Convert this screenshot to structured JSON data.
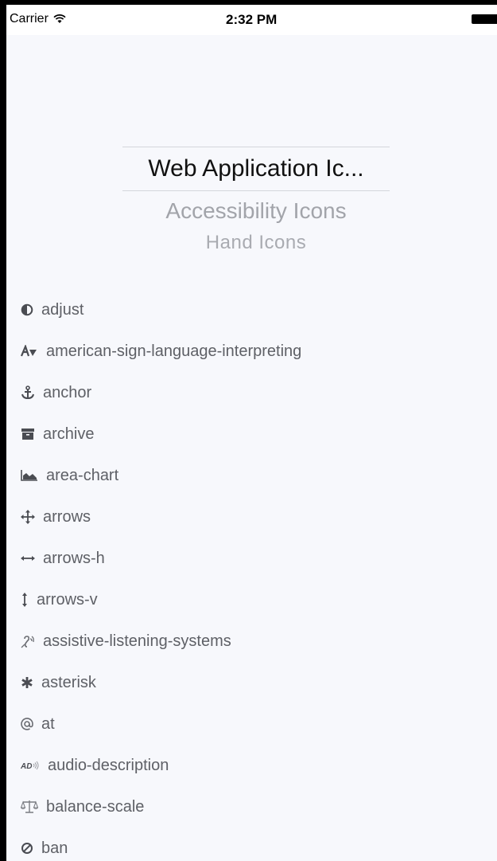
{
  "status_bar": {
    "carrier": "Carrier",
    "time": "2:32 PM"
  },
  "picker": {
    "selected": "Web Application Ic...",
    "options": [
      "Accessibility Icons",
      "Hand Icons"
    ]
  },
  "icons": [
    {
      "icon": "adjust-icon",
      "label": "adjust"
    },
    {
      "icon": "american-sign-language-icon",
      "label": "american-sign-language-interpreting"
    },
    {
      "icon": "anchor-icon",
      "label": "anchor"
    },
    {
      "icon": "archive-icon",
      "label": "archive"
    },
    {
      "icon": "area-chart-icon",
      "label": "area-chart"
    },
    {
      "icon": "arrows-icon",
      "label": "arrows"
    },
    {
      "icon": "arrows-h-icon",
      "label": "arrows-h"
    },
    {
      "icon": "arrows-v-icon",
      "label": "arrows-v"
    },
    {
      "icon": "assistive-listening-icon",
      "label": "assistive-listening-systems"
    },
    {
      "icon": "asterisk-icon",
      "label": "asterisk"
    },
    {
      "icon": "at-icon",
      "label": "at"
    },
    {
      "icon": "audio-description-icon",
      "label": "audio-description"
    },
    {
      "icon": "balance-scale-icon",
      "label": "balance-scale"
    },
    {
      "icon": "ban-icon",
      "label": "ban"
    }
  ],
  "colors": {
    "background": "#f7f8fc",
    "icon_text": "#5e6066",
    "picker_selected": "#111111",
    "picker_option": "#a2a4aa"
  }
}
